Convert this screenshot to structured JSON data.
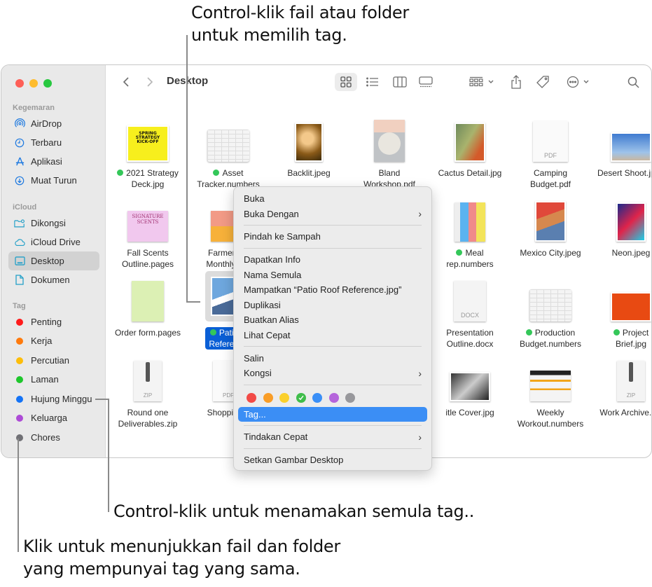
{
  "callouts": {
    "top_line1": "Control-klik fail atau folder",
    "top_line2": "untuk memilih tag.",
    "middle": "Control-klik untuk menamakan semula tag..",
    "bottom_line1": "Klik untuk menunjukkan fail dan folder",
    "bottom_line2": "yang mempunyai tag yang sama."
  },
  "window": {
    "traffic_lights": [
      "#fe5f57",
      "#febc2e",
      "#28c840"
    ],
    "sidebar": {
      "favorites_label": "Kegemaran",
      "favorites": [
        {
          "label": "AirDrop",
          "icon": "airdrop-icon"
        },
        {
          "label": "Terbaru",
          "icon": "clock-icon"
        },
        {
          "label": "Aplikasi",
          "icon": "applications-icon"
        },
        {
          "label": "Muat Turun",
          "icon": "download-icon"
        }
      ],
      "icloud_label": "iCloud",
      "icloud": [
        {
          "label": "Dikongsi",
          "icon": "shared-folder-icon"
        },
        {
          "label": "iCloud Drive",
          "icon": "cloud-icon"
        },
        {
          "label": "Desktop",
          "icon": "desktop-icon",
          "selected": true
        },
        {
          "label": "Dokumen",
          "icon": "document-icon"
        }
      ],
      "tags_label": "Tag",
      "tags": [
        {
          "label": "Penting",
          "color": "#fe1b1b"
        },
        {
          "label": "Kerja",
          "color": "#fe7a0c"
        },
        {
          "label": "Percutian",
          "color": "#fdbd0a"
        },
        {
          "label": "Laman",
          "color": "#1ec72c"
        },
        {
          "label": "Hujung Minggu",
          "color": "#1473f6"
        },
        {
          "label": "Keluarga",
          "color": "#ad4bd6"
        },
        {
          "label": "Chores",
          "color": "#707075"
        }
      ]
    },
    "toolbar": {
      "back": "chevron-left-icon",
      "forward": "chevron-right-icon",
      "title": "Desktop",
      "view_modes": [
        "icon-view",
        "list-view",
        "column-view",
        "gallery-view"
      ],
      "active_view": "icon-view"
    },
    "files": [
      {
        "line1": "2021 Strategy",
        "line2": "Deck.jpg",
        "tag": "green",
        "thumb": "spring-poster"
      },
      {
        "line1": "Asset",
        "line2": "Tracker.numbers",
        "tag": "green",
        "thumb": "spreadsheet"
      },
      {
        "line1": "Backlit.jpeg",
        "line2": "",
        "thumb": "portrait"
      },
      {
        "line1": "Bland",
        "line2": "Workshop.pdf",
        "thumb": "pdf-workshop"
      },
      {
        "line1": "Cactus Detail.jpg",
        "line2": "",
        "thumb": "cactus"
      },
      {
        "line1": "Camping",
        "line2": "Budget.pdf",
        "thumb": "pdf-doc"
      },
      {
        "line1": "Desert Shoot.jpeg",
        "line2": "",
        "thumb": "desert"
      },
      {
        "line1": "Fall Scents",
        "line2": "Outline.pages",
        "thumb": "pages-pink"
      },
      {
        "line1": "Farmers M",
        "line2": "Monthly...ck",
        "thumb": "pdf-farmers"
      },
      {
        "line1": "Meal",
        "line2": "rep.numbers",
        "tag": "green",
        "thumb": "meal-sheet"
      },
      {
        "line1": "Mexico City.jpeg",
        "line2": "",
        "thumb": "mexico"
      },
      {
        "line1": "Neon.jpeg",
        "line2": "",
        "thumb": "neon"
      },
      {
        "line1": "Order form.pages",
        "line2": "",
        "thumb": "pages-green"
      },
      {
        "line1": "Patio R",
        "line2": "Reference",
        "tag": "green",
        "selected": true,
        "thumb": "patio"
      },
      {
        "line1": "Presentation",
        "line2": "Outline.docx",
        "thumb": "docx"
      },
      {
        "line1": "Production",
        "line2": "Budget.numbers",
        "tag": "green",
        "thumb": "spreadsheet"
      },
      {
        "line1": "Project",
        "line2": "Brief.jpg",
        "tag": "green",
        "thumb": "brief"
      },
      {
        "line1": "Round one",
        "line2": "Deliverables.zip",
        "thumb": "zip"
      },
      {
        "line1": "Shopping L",
        "line2": "",
        "thumb": "pdf-shopping"
      },
      {
        "line1": "itle Cover.jpg",
        "line2": "",
        "thumb": "bw-cover"
      },
      {
        "line1": "Weekly",
        "line2": "Workout.numbers",
        "thumb": "workout-sheet"
      },
      {
        "line1": "Work Archive.zip",
        "line2": "",
        "thumb": "zip"
      }
    ],
    "doc_labels": {
      "pdf": "PDF",
      "docx": "DOCX",
      "zip": "ZIP"
    }
  },
  "context_menu": {
    "items": {
      "open": "Buka",
      "open_with": "Buka Dengan",
      "move_to_trash": "Pindah ke Sampah",
      "get_info": "Dapatkan Info",
      "rename": "Nama Semula",
      "compress": "Mampatkan “Patio Roof Reference.jpg”",
      "duplicate": "Duplikasi",
      "make_alias": "Buatkan Alias",
      "quick_look": "Lihat Cepat",
      "copy": "Salin",
      "share": "Kongsi",
      "tags": "Tag...",
      "quick_actions": "Tindakan Cepat",
      "set_desktop_picture": "Setkan Gambar Desktop"
    },
    "tag_colors": [
      {
        "name": "red",
        "color": "#f24a46",
        "checked": false
      },
      {
        "name": "orange",
        "color": "#f99d27",
        "checked": false
      },
      {
        "name": "yellow",
        "color": "#fbd02c",
        "checked": false
      },
      {
        "name": "green",
        "color": "#3fbd4a",
        "checked": true
      },
      {
        "name": "blue",
        "color": "#3a8ff7",
        "checked": false
      },
      {
        "name": "purple",
        "color": "#b565db",
        "checked": false
      },
      {
        "name": "gray",
        "color": "#98989c",
        "checked": false
      }
    ],
    "highlighted": "Tag..."
  }
}
